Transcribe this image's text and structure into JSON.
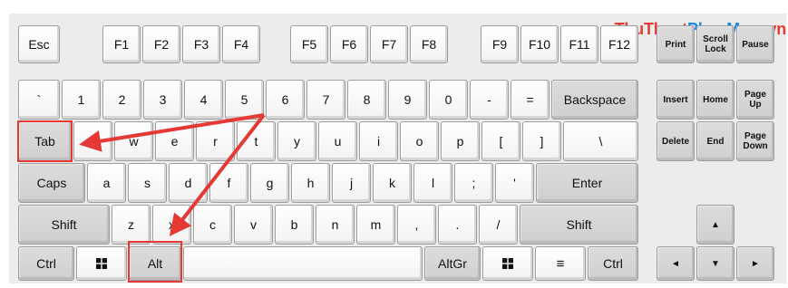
{
  "watermark": {
    "part1": "ThuThuat",
    "part2": "PhanMem",
    "part3": ".vn"
  },
  "colors": {
    "highlight": "#e53935",
    "arrow": "#e53935",
    "board": "#ececec",
    "key": "#ffffff",
    "key_dark": "#d3d3d3"
  },
  "highlighted_keys": [
    "Tab",
    "Alt"
  ],
  "keys": {
    "esc": "Esc",
    "f1": "F1",
    "f2": "F2",
    "f3": "F3",
    "f4": "F4",
    "f5": "F5",
    "f6": "F6",
    "f7": "F7",
    "f8": "F8",
    "f9": "F9",
    "f10": "F10",
    "f11": "F11",
    "f12": "F12",
    "print": "Print",
    "scroll_lock": "Scroll\nLock",
    "pause": "Pause",
    "backtick": "`",
    "n1": "1",
    "n2": "2",
    "n3": "3",
    "n4": "4",
    "n5": "5",
    "n6": "6",
    "n7": "7",
    "n8": "8",
    "n9": "9",
    "n0": "0",
    "minus": "-",
    "equals": "=",
    "backspace": "Backspace",
    "insert": "Insert",
    "home": "Home",
    "page_up": "Page\nUp",
    "tab": "Tab",
    "q": "q",
    "w": "w",
    "e": "e",
    "r": "r",
    "t": "t",
    "y": "y",
    "u": "u",
    "i": "i",
    "o": "o",
    "p": "p",
    "lbracket": "[",
    "rbracket": "]",
    "backslash": "\\",
    "delete": "Delete",
    "end": "End",
    "page_down": "Page\nDown",
    "caps": "Caps",
    "a": "a",
    "s": "s",
    "d": "d",
    "f": "f",
    "g": "g",
    "h": "h",
    "j": "j",
    "k": "k",
    "l": "l",
    "semicolon": ";",
    "quote": "'",
    "enter": "Enter",
    "shift_left": "Shift",
    "z": "z",
    "x": "x",
    "c": "c",
    "v": "v",
    "b": "b",
    "n": "n",
    "m": "m",
    "comma": ",",
    "period": ".",
    "slash": "/",
    "shift_right": "Shift",
    "up": "▲",
    "ctrl_left": "Ctrl",
    "alt": "Alt",
    "altgr": "AltGr",
    "menu": "≡",
    "ctrl_right": "Ctrl",
    "left": "◄",
    "down": "▼",
    "right": "►"
  },
  "icons": {
    "windows_left": "windows-icon",
    "windows_right": "windows-icon"
  }
}
